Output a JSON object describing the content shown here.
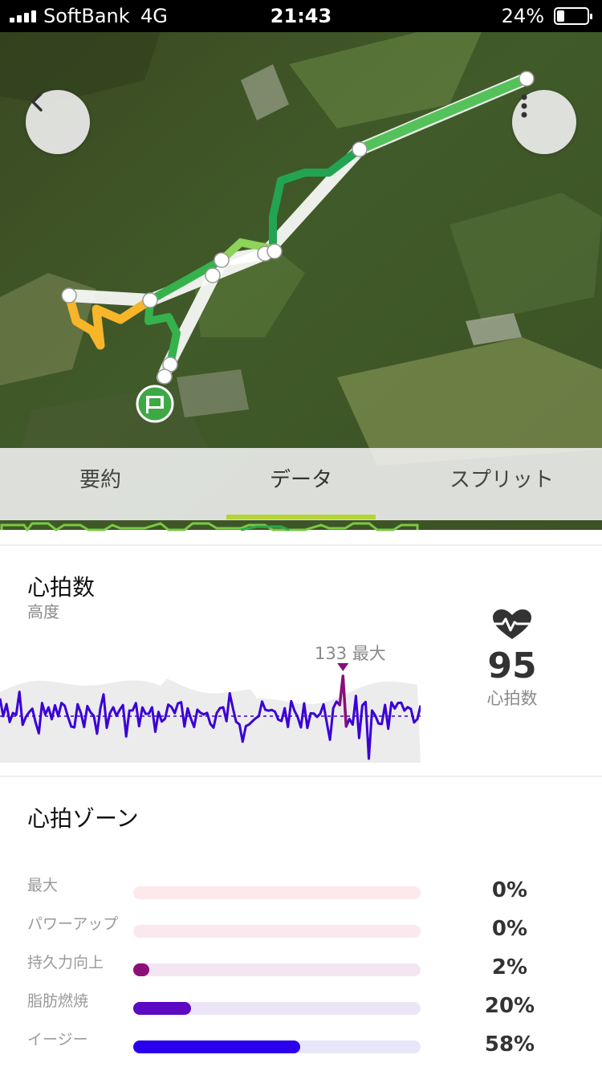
{
  "status_bar": {
    "carrier": "SoftBank",
    "network": "4G",
    "time": "21:43",
    "battery_percent": "24%",
    "battery_level": 0.24
  },
  "map": {
    "back_icon": "chevron-left-icon",
    "more_icon": "more-vertical-icon",
    "start_icon": "flag-icon",
    "colors": {
      "route_green": "#4cbf4a",
      "route_dark_green": "#2fa84b",
      "route_orange": "#f7b52a",
      "route_white": "#ffffff"
    }
  },
  "tabs": [
    {
      "label": "要約",
      "active": false
    },
    {
      "label": "データ",
      "active": true
    },
    {
      "label": "スプリット",
      "active": false
    }
  ],
  "heart_rate": {
    "title": "心拍数",
    "subtitle": "高度",
    "max_label": "133 最大",
    "value": "95",
    "unit": "心拍数",
    "icon": "heart-rate-icon",
    "line_color": "#3a00d6",
    "peak_color": "#8a0e7a"
  },
  "zones": {
    "title": "心拍ゾーン",
    "items": [
      {
        "label": "最大",
        "percent": "0%",
        "value": 0.0,
        "track": "#fde8ea",
        "fill": "#f3a6b0"
      },
      {
        "label": "パワーアップ",
        "percent": "0%",
        "value": 0.0,
        "track": "#fbe8ef",
        "fill": "#e36a9a"
      },
      {
        "label": "持久力向上",
        "percent": "2%",
        "value": 0.02,
        "track": "#f4e5f2",
        "fill": "#8c0f79"
      },
      {
        "label": "脂肪燃焼",
        "percent": "20%",
        "value": 0.2,
        "track": "#ece5f8",
        "fill": "#5b09c2"
      },
      {
        "label": "イージー",
        "percent": "58%",
        "value": 0.58,
        "track": "#e8e6fb",
        "fill": "#2b00ee"
      }
    ]
  }
}
